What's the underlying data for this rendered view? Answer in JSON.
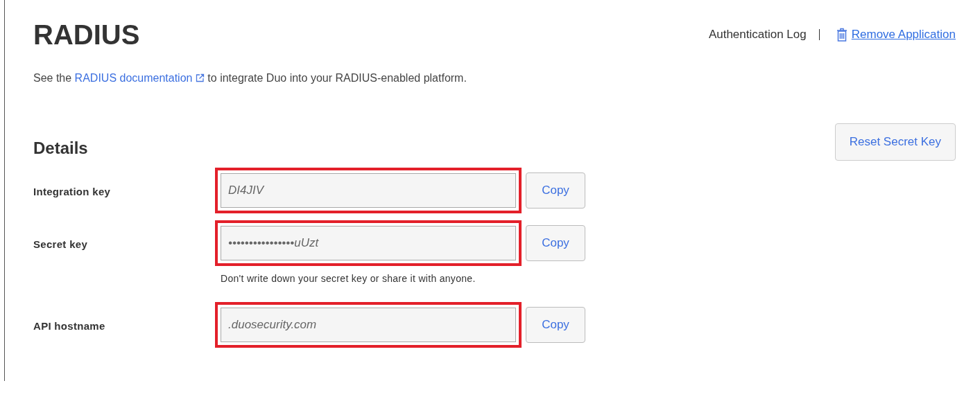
{
  "header": {
    "title": "RADIUS",
    "links": [
      {
        "label": "Authentication Log",
        "kind": "plain"
      },
      {
        "label": "Remove Application",
        "kind": "remove"
      }
    ]
  },
  "intro": {
    "before": "See the ",
    "link": "RADIUS documentation",
    "after": " to integrate Duo into your RADIUS-enabled platform."
  },
  "details": {
    "heading": "Details",
    "reset_button": "Reset Secret Key",
    "fields": [
      {
        "label": "Integration key",
        "value": "DI4JIV",
        "highlighted": true,
        "button": "Copy"
      },
      {
        "label": "Secret key",
        "value": "••••••••••••••••uUzt",
        "highlighted": true,
        "button": "Copy",
        "hint": "Don't write down your secret key or share it with anyone."
      },
      {
        "label": "API hostname",
        "value": ".duosecurity.com",
        "highlighted": true,
        "button": "Copy"
      }
    ]
  }
}
